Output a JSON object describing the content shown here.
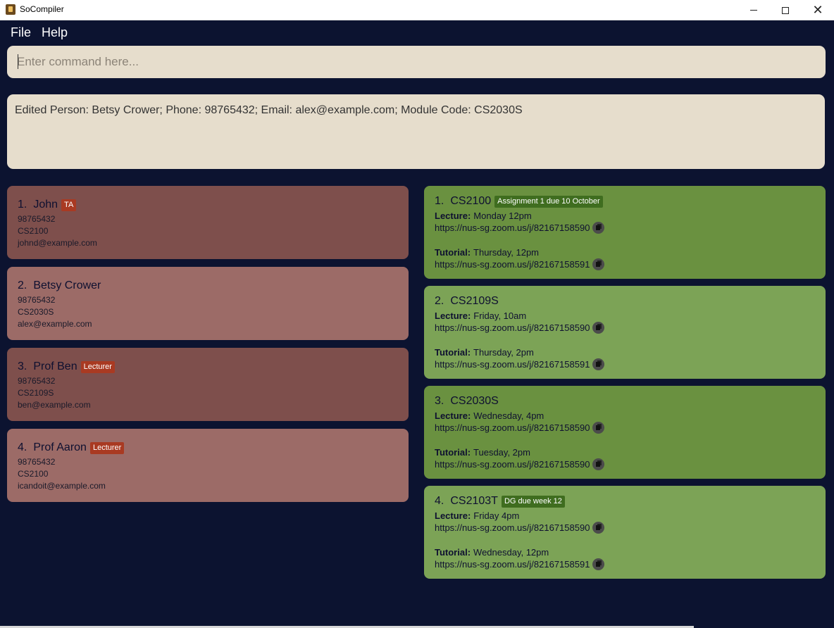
{
  "window": {
    "title": "SoCompiler"
  },
  "menu": {
    "file": "File",
    "help": "Help"
  },
  "command": {
    "placeholder": "Enter command here..."
  },
  "result": {
    "text": "Edited Person: Betsy Crower; Phone: 98765432; Email: alex@example.com; Module Code: CS2030S"
  },
  "persons": [
    {
      "index": "1.",
      "name": "John",
      "tag": "TA",
      "phone": "98765432",
      "module": "CS2100",
      "email": "johnd@example.com"
    },
    {
      "index": "2.",
      "name": "Betsy Crower",
      "tag": "",
      "phone": "98765432",
      "module": "CS2030S",
      "email": "alex@example.com"
    },
    {
      "index": "3.",
      "name": "Prof Ben",
      "tag": "Lecturer",
      "phone": "98765432",
      "module": "CS2109S",
      "email": "ben@example.com"
    },
    {
      "index": "4.",
      "name": "Prof Aaron",
      "tag": "Lecturer",
      "phone": "98765432",
      "module": "CS2100",
      "email": "icandoit@example.com"
    }
  ],
  "modules": [
    {
      "index": "1.",
      "code": "CS2100",
      "tag": "Assignment 1 due 10 October",
      "lecture_label": "Lecture:",
      "lecture_time": "Monday 12pm",
      "lecture_link": "https://nus-sg.zoom.us/j/82167158590",
      "tutorial_label": "Tutorial:",
      "tutorial_time": "Thursday, 12pm",
      "tutorial_link": "https://nus-sg.zoom.us/j/82167158591"
    },
    {
      "index": "2.",
      "code": "CS2109S",
      "tag": "",
      "lecture_label": "Lecture:",
      "lecture_time": "Friday, 10am",
      "lecture_link": "https://nus-sg.zoom.us/j/82167158590",
      "tutorial_label": "Tutorial:",
      "tutorial_time": "Thursday, 2pm",
      "tutorial_link": "https://nus-sg.zoom.us/j/82167158591"
    },
    {
      "index": "3.",
      "code": "CS2030S",
      "tag": "",
      "lecture_label": "Lecture:",
      "lecture_time": "Wednesday, 4pm",
      "lecture_link": "https://nus-sg.zoom.us/j/82167158590",
      "tutorial_label": "Tutorial:",
      "tutorial_time": "Tuesday, 2pm",
      "tutorial_link": "https://nus-sg.zoom.us/j/82167158590"
    },
    {
      "index": "4.",
      "code": "CS2103T",
      "tag": "DG due week 12",
      "lecture_label": "Lecture:",
      "lecture_time": "Friday 4pm",
      "lecture_link": "https://nus-sg.zoom.us/j/82167158590",
      "tutorial_label": "Tutorial:",
      "tutorial_time": "Wednesday, 12pm",
      "tutorial_link": "https://nus-sg.zoom.us/j/82167158591"
    }
  ],
  "colors": {
    "background": "#0c1330",
    "input_bg": "#e6ddcc",
    "person_dark": "#7e4f4c",
    "person_light": "#9c6b67",
    "module_dark": "#6a9140",
    "module_light": "#7ca356",
    "person_tag": "#a93a22",
    "module_tag": "#3f6d1f"
  },
  "icons": {
    "copy": "copy-icon",
    "app": "app-icon",
    "minimize": "minimize-icon",
    "maximize": "maximize-icon",
    "close": "close-icon"
  }
}
